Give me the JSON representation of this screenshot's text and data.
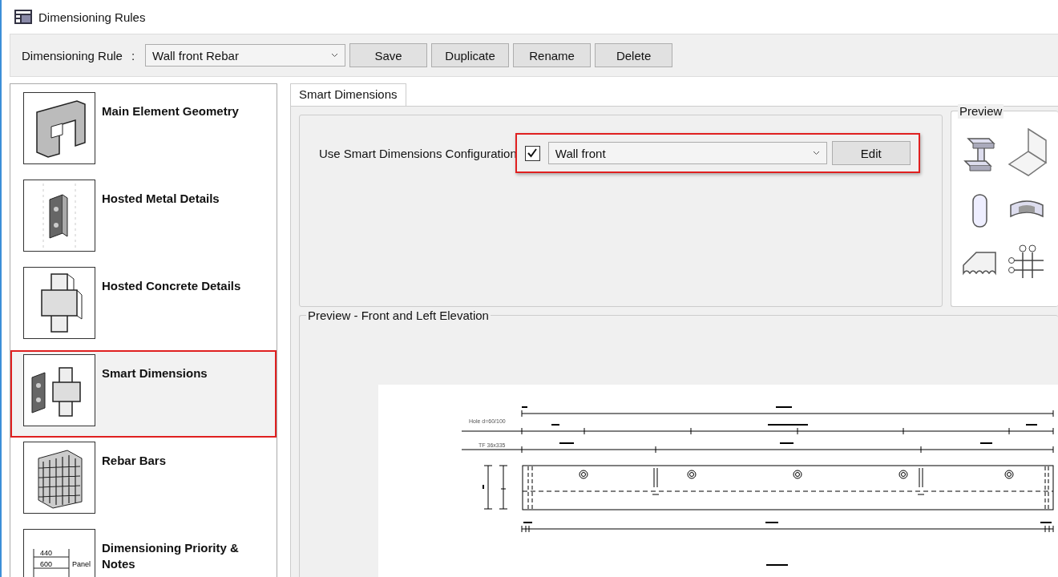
{
  "window": {
    "title": "Dimensioning Rules"
  },
  "rule_bar": {
    "label": "Dimensioning Rule",
    "separator": ":",
    "value": "Wall front Rebar",
    "buttons": [
      "Save",
      "Duplicate",
      "Rename",
      "Delete"
    ]
  },
  "sidebar": {
    "items": [
      {
        "label": "Main Element Geometry",
        "kind": "geometry",
        "selected": false
      },
      {
        "label": "Hosted Metal Details",
        "kind": "metal",
        "selected": false
      },
      {
        "label": "Hosted Concrete Details",
        "kind": "concrete",
        "selected": false
      },
      {
        "label": "Smart Dimensions",
        "kind": "smart",
        "selected": true
      },
      {
        "label": "Rebar Bars",
        "kind": "rebar",
        "selected": false
      },
      {
        "label": "Dimensioning Priority & Notes",
        "kind": "priority",
        "selected": false,
        "thumbnail_labels": [
          "440",
          "600",
          "Panel"
        ]
      }
    ]
  },
  "tabs": [
    {
      "label": "Smart Dimensions",
      "selected": true
    }
  ],
  "configuration": {
    "label": "Use Smart Dimensions Configuration",
    "checked": true,
    "value": "Wall front",
    "button": "Edit",
    "highlighted": true
  },
  "preview_palette": {
    "title": "Preview"
  },
  "elevation_preview": {
    "title": "Preview - Front and Left Elevation",
    "labels": [
      "Hole d=60/100",
      "TF 36x335"
    ]
  }
}
